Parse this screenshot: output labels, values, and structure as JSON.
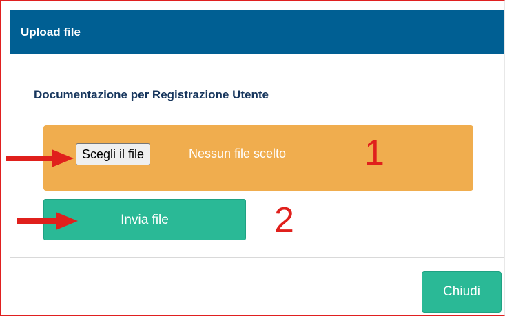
{
  "dialog": {
    "title": "Upload file",
    "section_title": "Documentazione per Registrazione Utente"
  },
  "file_input": {
    "choose_label": "Scegli il file",
    "status_text": "Nessun file scelto"
  },
  "buttons": {
    "send_label": "Invia file",
    "close_label": "Chiudi"
  },
  "annotations": {
    "step_1": "1",
    "step_2": "2",
    "arrow_color": "#e0201c"
  },
  "colors": {
    "header": "#005f93",
    "panel": "#f0ad4e",
    "accent": "#2ab996"
  }
}
